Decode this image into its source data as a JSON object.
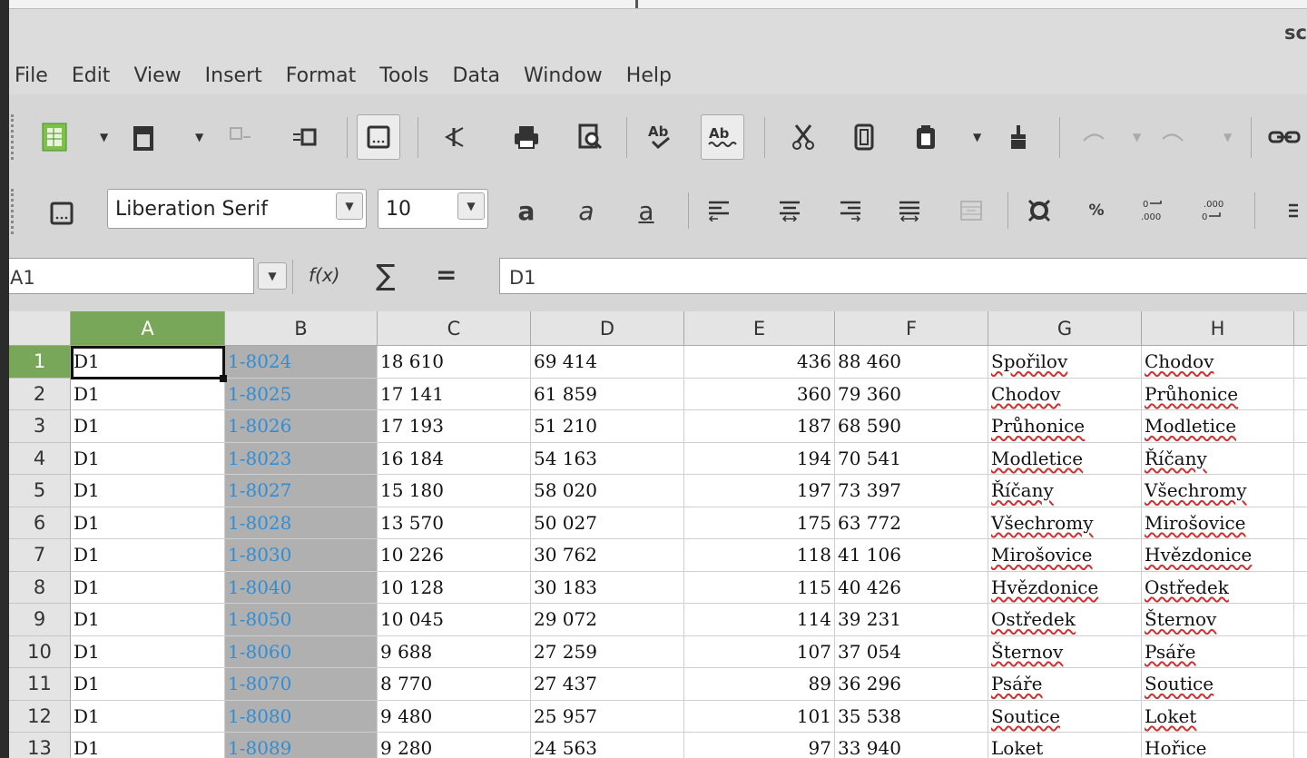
{
  "window": {
    "title": "sc"
  },
  "menu": [
    "File",
    "Edit",
    "View",
    "Insert",
    "Format",
    "Tools",
    "Data",
    "Window",
    "Help"
  ],
  "formatting": {
    "font_name": "Liberation Serif",
    "font_size": "10"
  },
  "formula_bar": {
    "name_box": "A1",
    "fx_label": "f(x)",
    "sum_symbol": "∑",
    "equals_symbol": "=",
    "content": "D1"
  },
  "columns": [
    "A",
    "B",
    "C",
    "D",
    "E",
    "F",
    "G",
    "H"
  ],
  "rows": [
    {
      "num": "1",
      "a": "D1",
      "b": "1-8024",
      "c": "18 610",
      "d": "69 414",
      "e": "436",
      "f": "88 460",
      "g": "Spořilov",
      "h": "Chodov"
    },
    {
      "num": "2",
      "a": "D1",
      "b": "1-8025",
      "c": "17 141",
      "d": "61 859",
      "e": "360",
      "f": "79 360",
      "g": "Chodov",
      "h": "Průhonice"
    },
    {
      "num": "3",
      "a": "D1",
      "b": "1-8026",
      "c": "17 193",
      "d": "51 210",
      "e": "187",
      "f": "68 590",
      "g": "Průhonice",
      "h": "Modletice"
    },
    {
      "num": "4",
      "a": "D1",
      "b": "1-8023",
      "c": "16 184",
      "d": "54 163",
      "e": "194",
      "f": "70 541",
      "g": "Modletice",
      "h": "Říčany"
    },
    {
      "num": "5",
      "a": "D1",
      "b": "1-8027",
      "c": "15 180",
      "d": "58 020",
      "e": "197",
      "f": "73 397",
      "g": "Říčany",
      "h": "Všechromy"
    },
    {
      "num": "6",
      "a": "D1",
      "b": "1-8028",
      "c": "13 570",
      "d": "50 027",
      "e": "175",
      "f": "63 772",
      "g": "Všechromy",
      "h": "Mirošovice"
    },
    {
      "num": "7",
      "a": "D1",
      "b": "1-8030",
      "c": "10 226",
      "d": "30 762",
      "e": "118",
      "f": "41 106",
      "g": "Mirošovice",
      "h": "Hvězdonice"
    },
    {
      "num": "8",
      "a": "D1",
      "b": "1-8040",
      "c": "10 128",
      "d": "30 183",
      "e": "115",
      "f": "40 426",
      "g": "Hvězdonice",
      "h": "Ostředek"
    },
    {
      "num": "9",
      "a": "D1",
      "b": "1-8050",
      "c": "10 045",
      "d": "29 072",
      "e": "114",
      "f": "39 231",
      "g": "Ostředek",
      "h": "Šternov"
    },
    {
      "num": "10",
      "a": "D1",
      "b": "1-8060",
      "c": "9 688",
      "d": "27 259",
      "e": "107",
      "f": "37 054",
      "g": "Šternov",
      "h": "Psáře"
    },
    {
      "num": "11",
      "a": "D1",
      "b": "1-8070",
      "c": "8 770",
      "d": "27 437",
      "e": "89",
      "f": "36 296",
      "g": "Psáře",
      "h": "Soutice"
    },
    {
      "num": "12",
      "a": "D1",
      "b": "1-8080",
      "c": "9 480",
      "d": "25 957",
      "e": "101",
      "f": "35 538",
      "g": "Soutice",
      "h": "Loket"
    },
    {
      "num": "13",
      "a": "D1",
      "b": "1-8089",
      "c": "9 280",
      "d": "24 563",
      "e": "97",
      "f": "33 940",
      "g": "Loket",
      "h": "Hořice"
    }
  ],
  "colors": {
    "selected_header": "#79a75a",
    "link_text": "#2f8ed6",
    "selected_column_fill": "#b0b0b0"
  }
}
